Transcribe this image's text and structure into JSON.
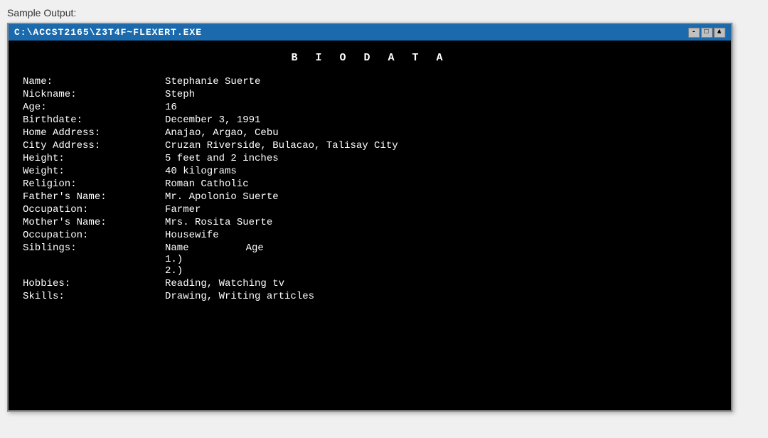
{
  "sample_label": "Sample Output:",
  "window": {
    "title": "C:\\ACCST2165\\Z3T4F~FLEXERT.EXE",
    "controls": [
      "-",
      "□",
      "▲"
    ]
  },
  "terminal": {
    "heading": "B I O D A T A",
    "fields": [
      {
        "label": "Name:",
        "value": "Stephanie Suerte"
      },
      {
        "label": "Nickname:",
        "value": "Steph"
      },
      {
        "label": "Age:",
        "value": "16"
      },
      {
        "label": "Birthdate:",
        "value": "December 3, 1991"
      },
      {
        "label": "Home Address:",
        "value": "Anajao, Argao, Cebu"
      },
      {
        "label": "City Address:",
        "value": "Cruzan Riverside, Bulacao, Talisay City"
      },
      {
        "label": "Height:",
        "value": "5 feet and 2 inches"
      },
      {
        "label": "Weight:",
        "value": "40 kilograms"
      },
      {
        "label": "Religion:",
        "value": "Roman Catholic"
      },
      {
        "label": "Father's Name:",
        "value": "Mr. Apolonio Suerte"
      },
      {
        "label": "Occupation:",
        "value": "Farmer"
      },
      {
        "label": "Mother's Name:",
        "value": "Mrs. Rosita Suerte"
      },
      {
        "label": "Occupation:",
        "value": "Housewife"
      }
    ],
    "siblings_label": "Siblings:",
    "siblings_col1": "Name",
    "siblings_col2": "Age",
    "siblings_items": [
      "1.)",
      "2.)"
    ],
    "hobbies_label": "Hobbies:",
    "hobbies_value": "Reading, Watching tv",
    "skills_label": "Skills:",
    "skills_value": "Drawing, Writing articles"
  }
}
